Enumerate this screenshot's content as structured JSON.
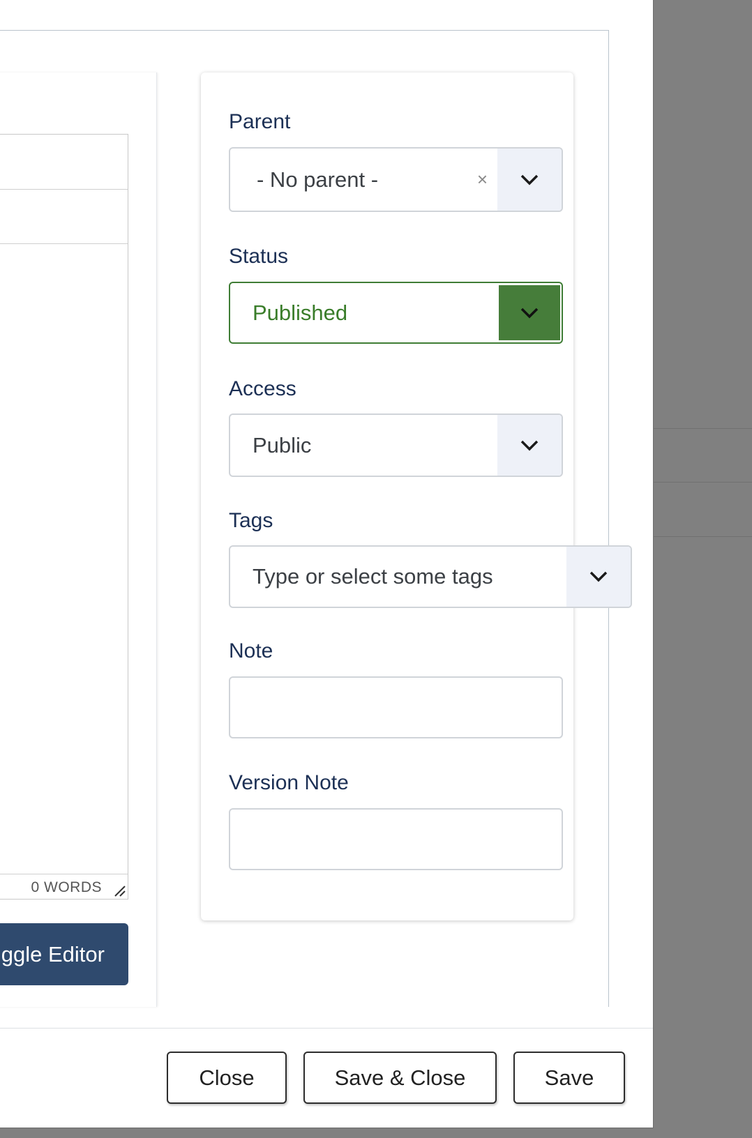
{
  "editor": {
    "word_count": "0 WORDS",
    "toggle_label": "ggle Editor"
  },
  "sidebar": {
    "parent": {
      "label": "Parent",
      "value": "- No parent -",
      "clear_symbol": "×"
    },
    "status": {
      "label": "Status",
      "value": "Published"
    },
    "access": {
      "label": "Access",
      "value": "Public"
    },
    "tags": {
      "label": "Tags",
      "placeholder": "Type or select some tags"
    },
    "note": {
      "label": "Note",
      "value": ""
    },
    "version_note": {
      "label": "Version Note",
      "value": ""
    }
  },
  "footer": {
    "close_label": "Close",
    "save_close_label": "Save & Close",
    "save_label": "Save"
  },
  "colors": {
    "status_green": "#467d3a",
    "label_navy": "#1c3055",
    "toggle_button": "#2f4a6e"
  },
  "icons": {
    "dropdown": "chevron-down-icon",
    "resize": "resize-handle-icon"
  }
}
